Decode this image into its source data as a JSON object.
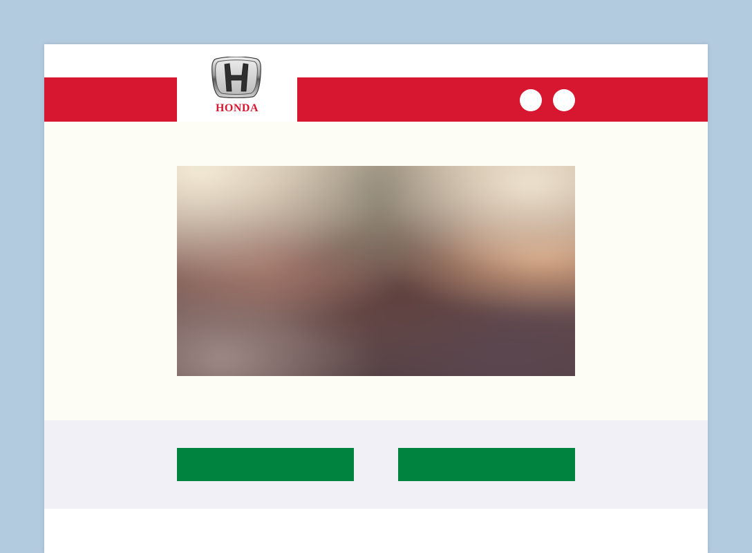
{
  "brand": {
    "wordmark": "HONDA",
    "logo_icon": "honda-h-emblem"
  },
  "header": {
    "dots": [
      {
        "icon": "white-circle"
      },
      {
        "icon": "white-circle"
      }
    ]
  },
  "hero": {
    "image": "blurred-photo-placeholder"
  },
  "actions": {
    "buttons": [
      {
        "label": ""
      },
      {
        "label": ""
      }
    ]
  },
  "colors": {
    "background": "#b3cbdf",
    "page": "#ffffff",
    "brand_red": "#d7172f",
    "content_bg": "#fdfdf5",
    "footer_bg": "#f1f0f7",
    "cta_green": "#00833e"
  }
}
